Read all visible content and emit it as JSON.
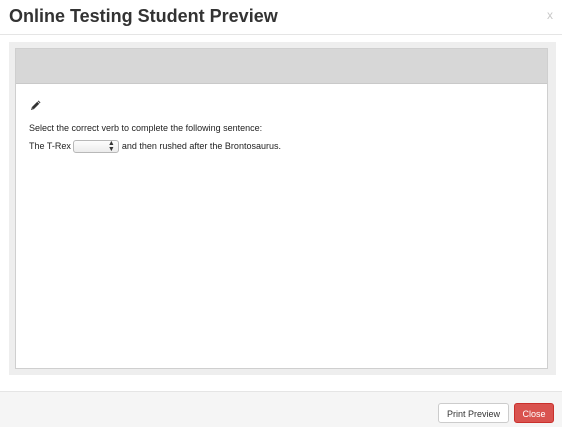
{
  "modal": {
    "title": "Online Testing Student Preview",
    "close_glyph": "x"
  },
  "question": {
    "edit_icon": "pencil-icon",
    "prompt": "Select the correct verb to complete the following sentence:",
    "sentence_before": "The T-Rex",
    "dropdown_value": "",
    "sentence_after": "and then rushed after the Brontosaurus."
  },
  "footer": {
    "print_preview_label": "Print Preview",
    "close_label": "Close"
  },
  "colors": {
    "close_button": "#d9534f",
    "preview_header_bar": "#d7d7d7",
    "body_background": "#eeeeee"
  }
}
